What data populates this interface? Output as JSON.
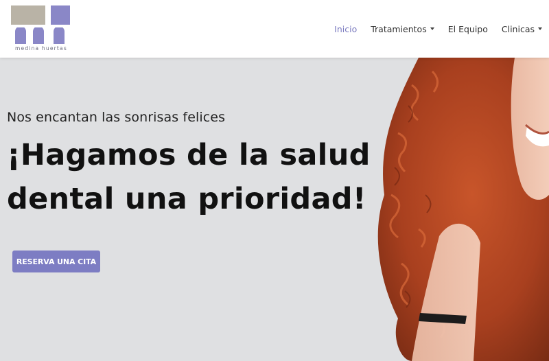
{
  "logo": {
    "text": "medina huertas",
    "icon": "mh-logo-icon"
  },
  "nav": {
    "items": [
      {
        "label": "Inicio",
        "active": true,
        "dropdown": false
      },
      {
        "label": "Tratamientos",
        "active": false,
        "dropdown": true
      },
      {
        "label": "El Equipo",
        "active": false,
        "dropdown": false
      },
      {
        "label": "Clinicas",
        "active": false,
        "dropdown": true
      }
    ]
  },
  "hero": {
    "subtitle": "Nos encantan las sonrisas felices",
    "headline_line1": "¡Hagamos de la salud",
    "headline_line2": "dental una prioridad!",
    "cta_label": "RESERVA UNA CITA",
    "image": "smiling-woman-curly-red-hair-photo"
  },
  "colors": {
    "accent": "#7d7dc3",
    "logo_tan": "#b9b3a6",
    "hero_bg": "#dfe0e2",
    "text_dark": "#111111"
  }
}
